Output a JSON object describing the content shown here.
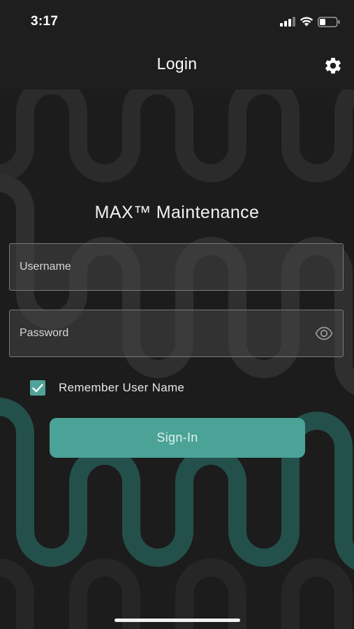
{
  "status_bar": {
    "time": "3:17",
    "icons": [
      "signal-icon",
      "wifi-icon",
      "battery-icon"
    ]
  },
  "nav": {
    "title": "Login",
    "settings_icon": "gear-icon"
  },
  "app_title": "MAX™ Maintenance",
  "form": {
    "username": {
      "placeholder": "Username",
      "value": ""
    },
    "password": {
      "placeholder": "Password",
      "value": "",
      "toggle_icon": "eye-icon"
    },
    "remember": {
      "label": "Remember User Name",
      "checked": true
    },
    "submit_label": "Sign-In"
  },
  "colors": {
    "accent": "#4aa396",
    "background": "#1c1c1c",
    "header": "#1e1e1e"
  }
}
